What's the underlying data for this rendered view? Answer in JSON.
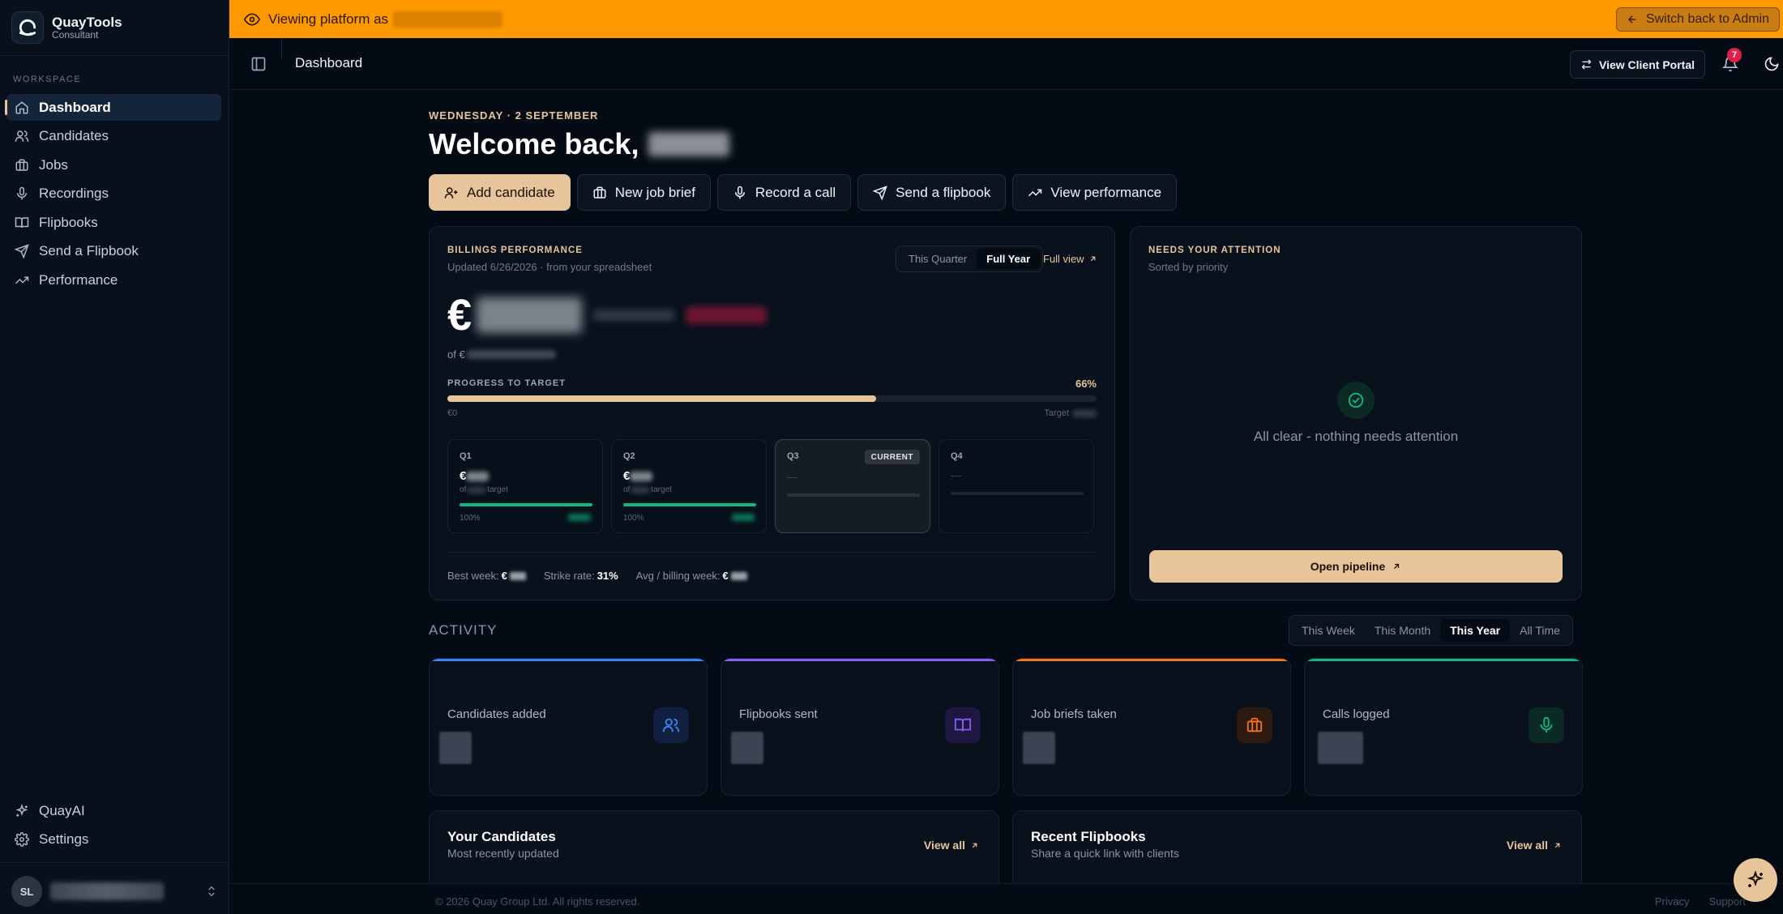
{
  "brand": {
    "name": "QuayTools",
    "role": "Consultant"
  },
  "sidebar": {
    "section_label": "WORKSPACE",
    "items": [
      {
        "label": "Dashboard",
        "icon": "home-icon",
        "active": true
      },
      {
        "label": "Candidates",
        "icon": "users-icon"
      },
      {
        "label": "Jobs",
        "icon": "briefcase-icon"
      },
      {
        "label": "Recordings",
        "icon": "mic-icon"
      },
      {
        "label": "Flipbooks",
        "icon": "book-icon"
      },
      {
        "label": "Send a Flipbook",
        "icon": "send-icon"
      },
      {
        "label": "Performance",
        "icon": "trend-icon"
      }
    ],
    "bottom_items": [
      {
        "label": "QuayAI",
        "icon": "sparkles-icon"
      },
      {
        "label": "Settings",
        "icon": "gear-icon"
      }
    ],
    "user_initials": "SL"
  },
  "banner": {
    "text": "Viewing platform as",
    "switch_label": "Switch back to Admin",
    "color": "#fe9a00"
  },
  "topbar": {
    "title": "Dashboard",
    "client_portal_label": "View Client Portal",
    "notification_count": "7"
  },
  "main": {
    "date": "WEDNESDAY · 2 SEPTEMBER",
    "welcome": "Welcome back,",
    "actions": [
      {
        "label": "Add candidate",
        "icon": "user-plus-icon",
        "primary": true
      },
      {
        "label": "New job brief",
        "icon": "briefcase-icon"
      },
      {
        "label": "Record a call",
        "icon": "mic-icon"
      },
      {
        "label": "Send a flipbook",
        "icon": "send-icon"
      },
      {
        "label": "View performance",
        "icon": "trend-icon"
      }
    ]
  },
  "billings": {
    "title": "BILLINGS PERFORMANCE",
    "updated": "Updated 6/26/2026 · from your spreadsheet",
    "tabs": [
      "This Quarter",
      "Full Year"
    ],
    "active_tab": "Full Year",
    "full_view": "Full view",
    "currency": "€",
    "target_prefix": "of €",
    "progress_label": "PROGRESS TO TARGET",
    "progress_pct": "66%",
    "progress_value": 0.66,
    "axis_start": "€0",
    "axis_end_prefix": "Target",
    "quarters": [
      {
        "name": "Q1",
        "amount": "€",
        "sub_prefix": "of",
        "sub_suffix": "target",
        "pct": "100%",
        "progress": 1.0
      },
      {
        "name": "Q2",
        "amount": "€",
        "sub_prefix": "of",
        "sub_suffix": "target",
        "pct": "100%",
        "progress": 1.0
      },
      {
        "name": "Q3",
        "dash": "—",
        "badge": "CURRENT"
      },
      {
        "name": "Q4",
        "dash": "—"
      }
    ],
    "stats": {
      "best_week_label": "Best week:",
      "best_week_value": "€",
      "strike_rate_label": "Strike rate:",
      "strike_rate_value": "31%",
      "avg_label": "Avg / billing week:",
      "avg_value": "€"
    }
  },
  "attention": {
    "title": "NEEDS YOUR ATTENTION",
    "subtitle": "Sorted by priority",
    "empty_text": "All clear - nothing needs attention",
    "button": "Open pipeline"
  },
  "activity": {
    "title": "ACTIVITY",
    "tabs": [
      "This Week",
      "This Month",
      "This Year",
      "All Time"
    ],
    "active_tab": "This Year",
    "cards": [
      {
        "label": "Candidates added",
        "color": "#3b82f6",
        "icon": "users-icon"
      },
      {
        "label": "Flipbooks sent",
        "color": "#8b5cf6",
        "icon": "book-icon"
      },
      {
        "label": "Job briefs taken",
        "color": "#f97316",
        "icon": "briefcase-icon"
      },
      {
        "label": "Calls logged",
        "color": "#10b981",
        "icon": "mic-icon"
      }
    ]
  },
  "lists": [
    {
      "title": "Your Candidates",
      "subtitle": "Most recently updated",
      "link": "View all"
    },
    {
      "title": "Recent Flipbooks",
      "subtitle": "Share a quick link with clients",
      "link": "View all"
    }
  ],
  "footer": {
    "copyright": "© 2026 Quay Group Ltd. All rights reserved.",
    "links": [
      "Privacy",
      "Support"
    ]
  },
  "colors": {
    "accent": "#e8c49a",
    "background": "#050b14",
    "card": "#08111c",
    "success": "#10b981"
  }
}
